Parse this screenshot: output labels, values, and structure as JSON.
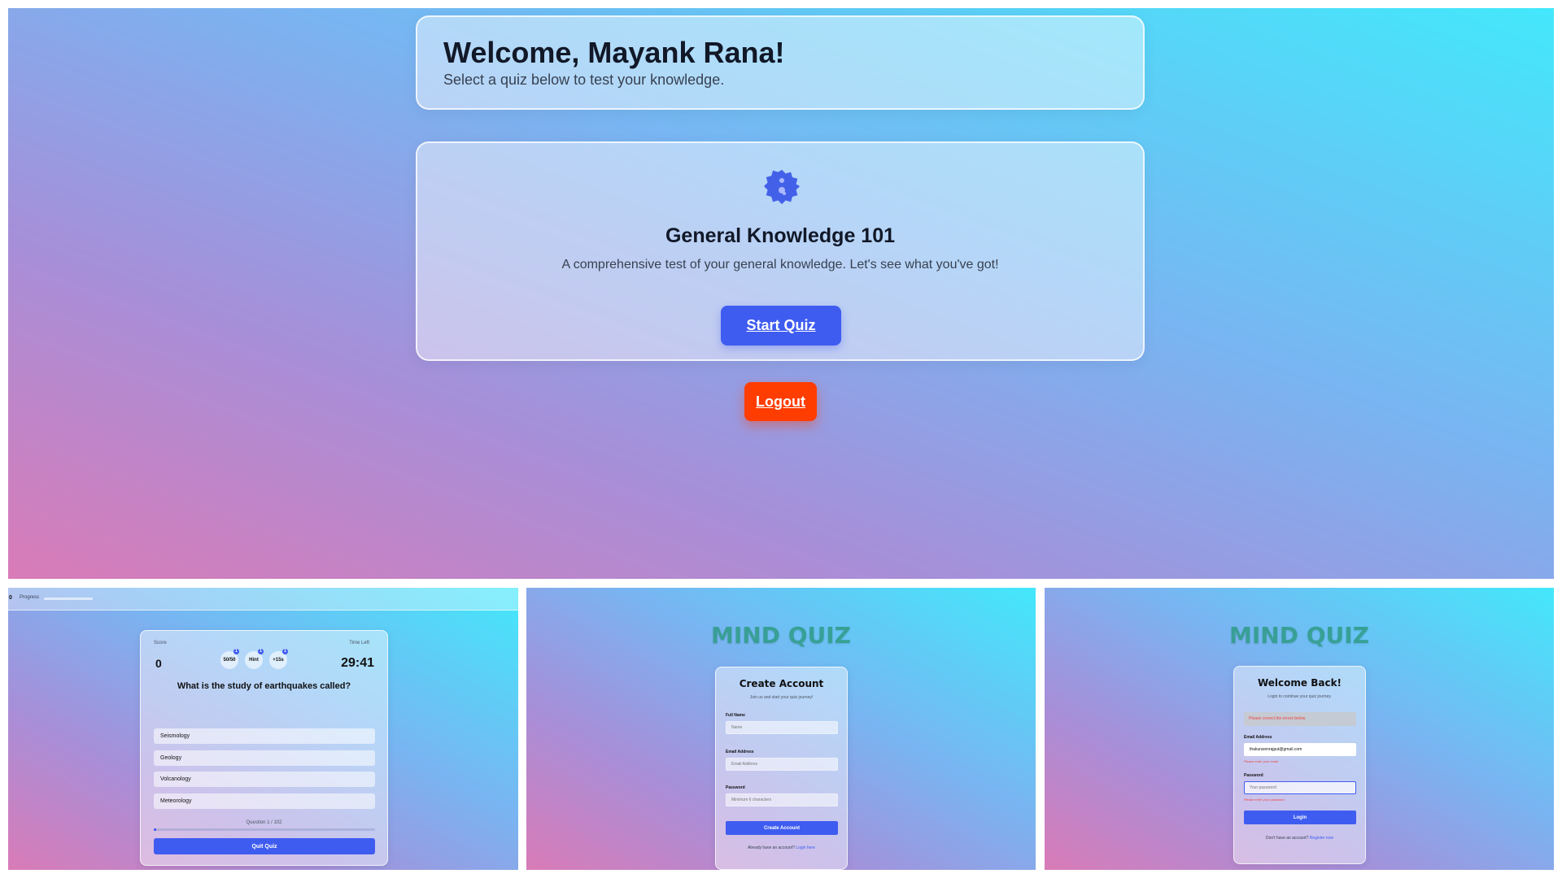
{
  "main": {
    "welcome_title": "Welcome, Mayank Rana!",
    "welcome_subtitle": "Select a quiz below to test your knowledge.",
    "quiz_icon": "quiz-badge-icon",
    "quiz_title": "General Knowledge 101",
    "quiz_description": "A comprehensive test of your general knowledge. Let's see what you've got!",
    "start_label": "Start Quiz",
    "logout_label": "Logout"
  },
  "quiz_screen": {
    "header_score": "0",
    "header_progress_label": "Progress",
    "score_label": "Score",
    "score_value": "0",
    "time_label": "Time Left",
    "time_value": "29:41",
    "lifelines": [
      {
        "label": "50/50",
        "badge": "1"
      },
      {
        "label": "Hint",
        "badge": "1"
      },
      {
        "label": "+15s",
        "badge": "1"
      }
    ],
    "question": "What is the study of earthquakes called?",
    "options": [
      "Seismology",
      "Geology",
      "Volcanology",
      "Meteorology"
    ],
    "question_counter": "Question 1 / 102",
    "progress_fraction": 0.0098,
    "quit_label": "Quit Quiz"
  },
  "register": {
    "brand": "MIND QUIZ",
    "heading": "Create Account",
    "subheading": "Join us and start your quiz journey!",
    "name_label": "Full Name",
    "name_placeholder": "Name",
    "email_label": "Email Address",
    "email_placeholder": "Email Address",
    "password_label": "Password",
    "password_placeholder": "Minimum 6 characters",
    "submit_label": "Create Account",
    "footer_text": "Already have an account?",
    "footer_link": "Login here"
  },
  "login": {
    "brand": "MIND QUIZ",
    "heading": "Welcome Back!",
    "subheading": "Login to continue your quiz journey.",
    "error_banner": "Please correct the errors below.",
    "email_label": "Email Address",
    "email_value": "thakurarenrajput@gmail.com",
    "email_error": "Please enter your email",
    "password_label": "Password",
    "password_placeholder": "Your password",
    "password_error": "Please enter your password.",
    "submit_label": "Login",
    "footer_text": "Don't have an account?",
    "footer_link": "Register now"
  },
  "colors": {
    "primary": "#3f5cf0",
    "logout": "#ff3d00",
    "brand_text": "#2f9b86",
    "error": "#ef4444"
  }
}
